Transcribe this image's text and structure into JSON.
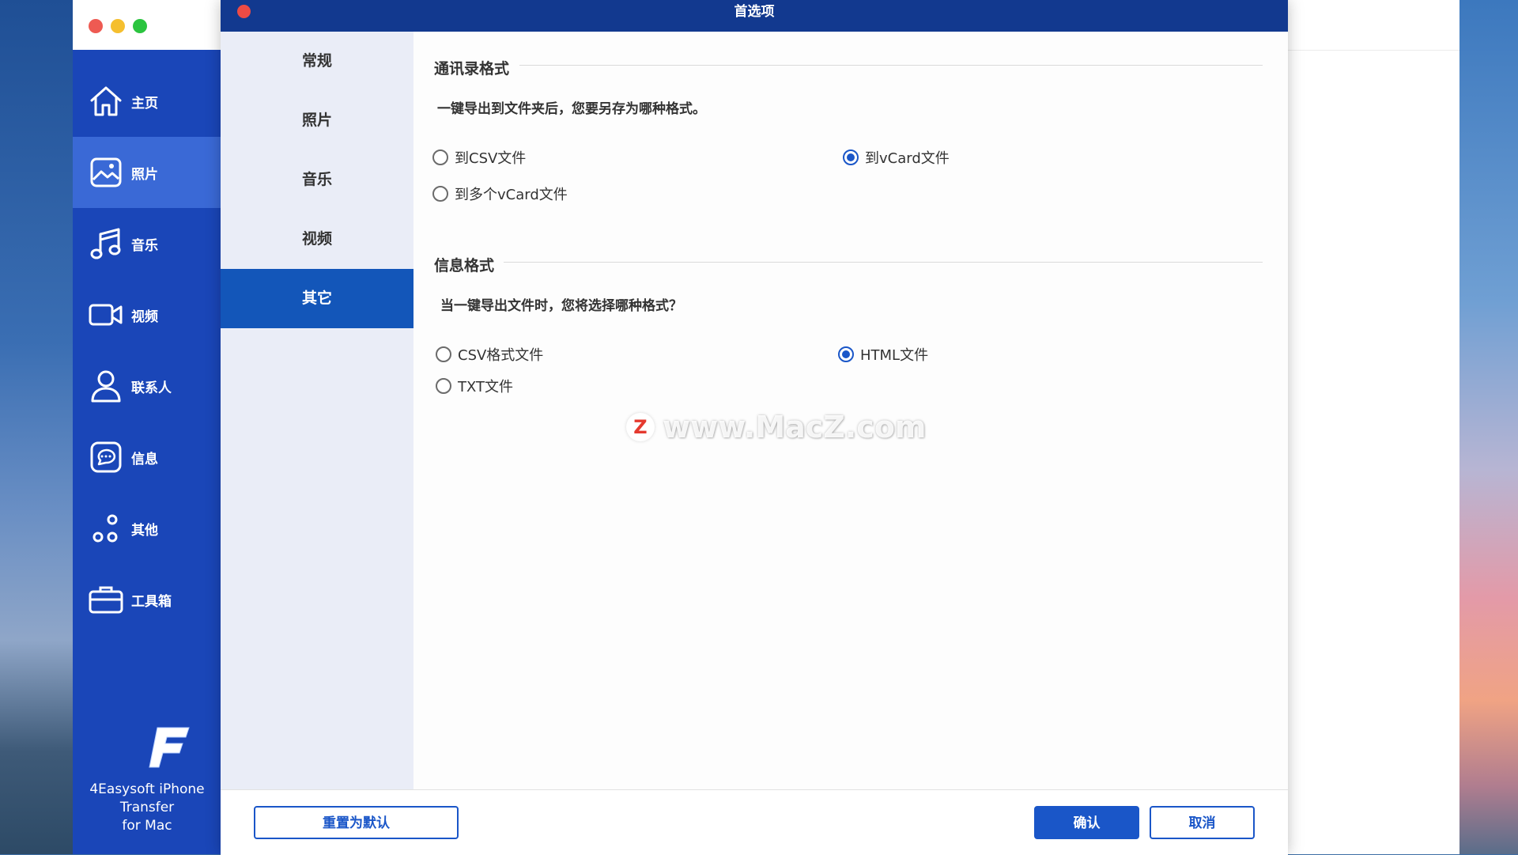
{
  "app": {
    "name": "4Easysoft iPhone Transfer\nfor Mac",
    "sidebar": [
      {
        "id": "home",
        "label": "主页",
        "icon": "home-icon",
        "active": false
      },
      {
        "id": "photos",
        "label": "照片",
        "icon": "photo-icon",
        "active": true
      },
      {
        "id": "music",
        "label": "音乐",
        "icon": "music-icon",
        "active": false
      },
      {
        "id": "video",
        "label": "视频",
        "icon": "video-icon",
        "active": false
      },
      {
        "id": "contacts",
        "label": "联系人",
        "icon": "contact-icon",
        "active": false
      },
      {
        "id": "messages",
        "label": "信息",
        "icon": "message-icon",
        "active": false
      },
      {
        "id": "other",
        "label": "其他",
        "icon": "other-icon",
        "active": false
      },
      {
        "id": "toolbox",
        "label": "工具箱",
        "icon": "toolbox-icon",
        "active": false
      }
    ]
  },
  "dialog": {
    "title": "首选项",
    "tabs": [
      {
        "label": "常规",
        "active": false
      },
      {
        "label": "照片",
        "active": false
      },
      {
        "label": "音乐",
        "active": false
      },
      {
        "label": "视频",
        "active": false
      },
      {
        "label": "其它",
        "active": true
      }
    ],
    "contacts_section": {
      "title": "通讯录格式",
      "description": "一键导出到文件夹后，您要另存为哪种格式。",
      "options": [
        {
          "label": "到CSV文件",
          "checked": false
        },
        {
          "label": "到vCard文件",
          "checked": true
        },
        {
          "label": "到多个vCard文件",
          "checked": false
        }
      ]
    },
    "messages_section": {
      "title": "信息格式",
      "description": "当一键导出文件时，您将选择哪种格式？",
      "options": [
        {
          "label": "CSV格式文件",
          "checked": false
        },
        {
          "label": "HTML文件",
          "checked": true
        },
        {
          "label": "TXT文件",
          "checked": false
        }
      ]
    },
    "buttons": {
      "reset": "重置为默认",
      "confirm": "确认",
      "cancel": "取消"
    }
  },
  "watermark": {
    "logo": "Z",
    "text": "www.MacZ.com"
  },
  "colors": {
    "sidebar": "#1a46b8",
    "sidebar_active": "#3a69d6",
    "dialog_title": "#12398f",
    "accent": "#1a56c8"
  }
}
